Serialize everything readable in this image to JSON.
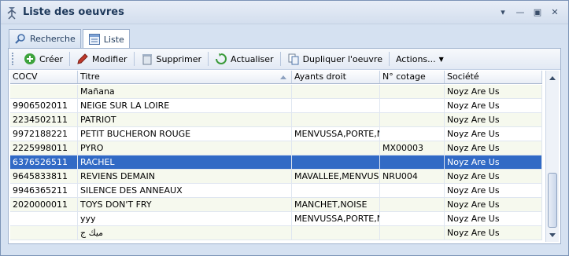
{
  "window": {
    "title": "Liste des oeuvres"
  },
  "tabs": [
    {
      "label": "Recherche",
      "active": false
    },
    {
      "label": "Liste",
      "active": true
    }
  ],
  "toolbar": {
    "create": "Créer",
    "edit": "Modifier",
    "delete": "Supprimer",
    "refresh": "Actualiser",
    "duplicate": "Dupliquer l'oeuvre",
    "actions": "Actions..."
  },
  "grid": {
    "columns": [
      "COCV",
      "Titre",
      "Ayants droit",
      "N° cotage",
      "Société"
    ],
    "sort_column": "Titre",
    "rows": [
      {
        "cocv": "",
        "titre": "Mañana",
        "ayants": "",
        "cotage": "",
        "societe": "Noyz Are Us"
      },
      {
        "cocv": "9906502011",
        "titre": "NEIGE SUR LA LOIRE",
        "ayants": "",
        "cotage": "",
        "societe": "Noyz Are Us"
      },
      {
        "cocv": "2234502111",
        "titre": "PATRIOT",
        "ayants": "",
        "cotage": "",
        "societe": "Noyz Are Us"
      },
      {
        "cocv": "9972188221",
        "titre": "PETIT BUCHERON ROUGE",
        "ayants": "MENVUSSA,PORTE,N",
        "cotage": "",
        "societe": "Noyz Are Us"
      },
      {
        "cocv": "2225998011",
        "titre": "PYRO",
        "ayants": "",
        "cotage": "MX00003",
        "societe": "Noyz Are Us"
      },
      {
        "cocv": "6376526511",
        "titre": "RACHEL",
        "ayants": "",
        "cotage": "",
        "societe": "Noyz Are Us",
        "selected": true
      },
      {
        "cocv": "9645833811",
        "titre": "REVIENS DEMAIN",
        "ayants": "MAVALLEE,MENVUSSA",
        "cotage": "NRU004",
        "societe": "Noyz Are Us"
      },
      {
        "cocv": "9946365211",
        "titre": "SILENCE DES ANNEAUX",
        "ayants": "",
        "cotage": "",
        "societe": "Noyz Are Us"
      },
      {
        "cocv": "2020000011",
        "titre": "TOYS DON'T FRY",
        "ayants": "MANCHET,NOISE",
        "cotage": "",
        "societe": "Noyz Are Us"
      },
      {
        "cocv": "",
        "titre": "yyy",
        "ayants": "MENVUSSA,PORTE,N",
        "cotage": "",
        "societe": "Noyz Are Us"
      },
      {
        "cocv": "",
        "titre": "ميك ج",
        "ayants": "",
        "cotage": "",
        "societe": "Noyz Are Us"
      }
    ]
  },
  "colors": {
    "selection": "#316ac5",
    "title": "#1e395b",
    "stripe": "#f6f9ee"
  }
}
